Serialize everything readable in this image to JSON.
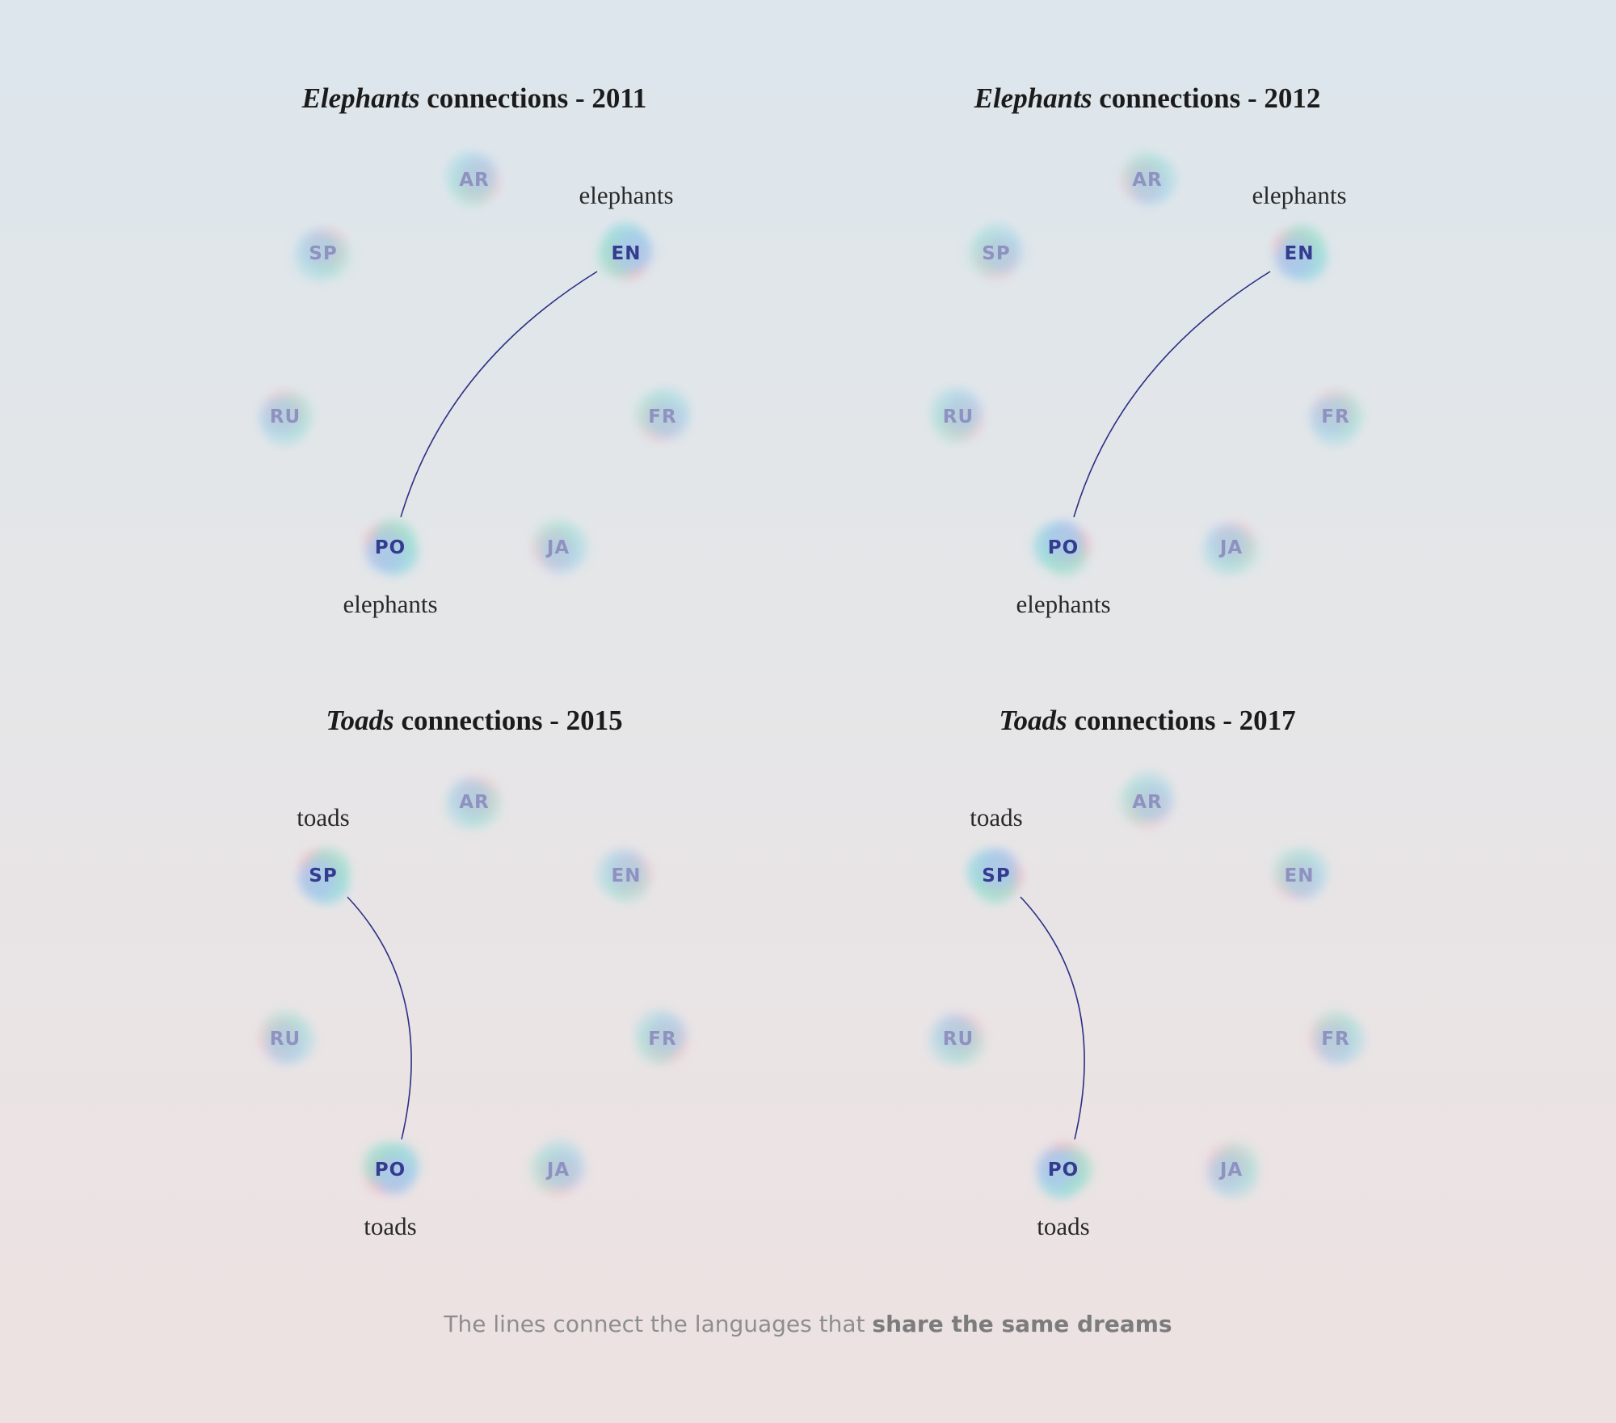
{
  "colors": {
    "line": "#2b2f83",
    "node_text_muted": "#8f92c0",
    "node_text_active": "#353b8f",
    "blob_cyan": "#8fd6e0",
    "blob_pink": "#f2aab8",
    "blob_teal": "#9fe0cf",
    "blob_blue": "#a9c6ef"
  },
  "languages": [
    "AR",
    "EN",
    "FR",
    "JA",
    "PO",
    "RU",
    "SP"
  ],
  "panels": [
    {
      "title_em": "Elephants",
      "title_rest": " connections - 2011",
      "connection": {
        "from": "EN",
        "to": "PO",
        "from_word": "elephants",
        "to_word": "elephants"
      }
    },
    {
      "title_em": "Elephants",
      "title_rest": " connections - 2012",
      "connection": {
        "from": "EN",
        "to": "PO",
        "from_word": "elephants",
        "to_word": "elephants"
      }
    },
    {
      "title_em": "Toads",
      "title_rest": " connections - 2015",
      "connection": {
        "from": "SP",
        "to": "PO",
        "from_word": "toads",
        "to_word": "toads"
      }
    },
    {
      "title_em": "Toads",
      "title_rest": " connections - 2017",
      "connection": {
        "from": "SP",
        "to": "PO",
        "from_word": "toads",
        "to_word": "toads"
      }
    }
  ],
  "footer": {
    "text": "The lines connect the languages that ",
    "strong": "share the same dreams"
  }
}
